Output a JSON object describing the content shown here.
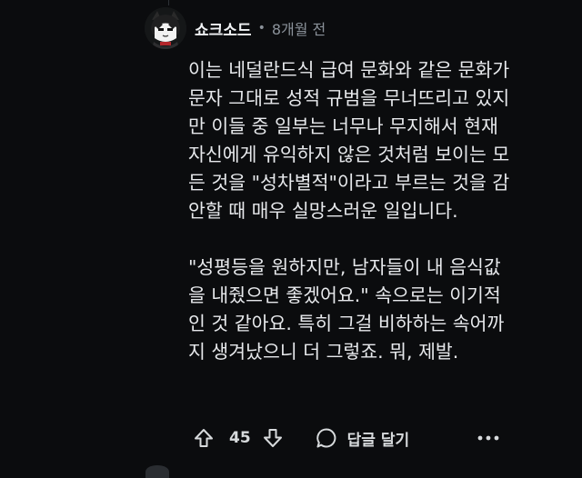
{
  "comment": {
    "author": "쇼크소드",
    "separator": "•",
    "time_ago": "8개월 전",
    "paragraphs": [
      {
        "lines": [
          "이는 네덜란드식 급여 문화와 같은 문화가",
          "문자 그대로 성적 규범을 무너뜨리고 있지",
          "만 이들 중 일부는 너무나 무지해서 현재",
          "자신에게 유익하지 않은 것처럼 보이는 모",
          "든 것을 \"성차별적\"이라고 부르는 것을 감",
          "안할 때 매우 실망스러운 일입니다."
        ]
      },
      {
        "lines": [
          "\"성평등을 원하지만, 남자들이 내 음식값",
          "을 내줬으면 좋겠어요.\" 속으로는 이기적",
          "인 것 같아요. 특히 그걸 비하하는 속어까",
          "지 생겨났으니 더 그렇죠. 뭐, 제발."
        ]
      }
    ],
    "actions": {
      "upvote_icon": "upvote-arrow-icon",
      "score": "45",
      "downvote_icon": "downvote-arrow-icon",
      "reply_icon": "speech-bubble-icon",
      "reply_label": "답글 달기",
      "more_icon": "ellipsis-icon"
    }
  }
}
